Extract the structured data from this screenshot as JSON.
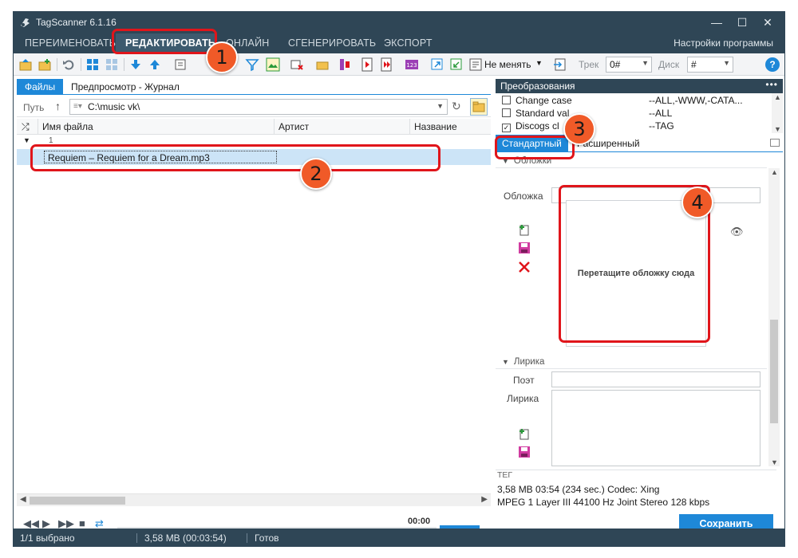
{
  "window": {
    "title": "TagScanner 6.1.16",
    "controls": [
      "—",
      "☐",
      "✕"
    ]
  },
  "menu": {
    "items": [
      "ПЕРЕИМЕНОВАТЬ",
      "РЕДАКТИРОВАТЬ",
      "ОНЛАЙН",
      "СГЕНЕРИРОВАТЬ",
      "ЭКСПОРТ"
    ],
    "active_index": 1,
    "settings": "Настройки программы"
  },
  "toolbar": {
    "keep_mode": "Не менять",
    "track_label": "Трек",
    "track_value": "0#",
    "disc_label": "Диск",
    "disc_value": "#",
    "help": "?"
  },
  "left_panel": {
    "tabs": [
      "Файлы",
      "Предпросмотр - Журнал"
    ],
    "path_label": "Путь",
    "path_value": "C:\\music vk\\",
    "columns": [
      "Имя файла",
      "Артист",
      "Название"
    ],
    "group_number": "1",
    "files": [
      {
        "name": "Requiem – Requiem for a Dream.mp3"
      }
    ]
  },
  "player": {
    "time": "00:00"
  },
  "right_panel": {
    "transform_title": "Преобразования",
    "transforms": [
      {
        "name": "Change case",
        "value": "--ALL,-WWW,-CATA...",
        "checked": false
      },
      {
        "name": "Standard val",
        "value": "--ALL",
        "checked": false
      },
      {
        "name": "Discogs cl",
        "value": "--TAG",
        "checked": true
      }
    ],
    "mode_tabs": [
      "Стандартный",
      "Расширенный"
    ],
    "covers_section": "Обложки",
    "cover_label": "Обложка",
    "drop_text": "Перетащите обложку сюда",
    "lyrics_section": "Лирика",
    "poet_label": "Поэт",
    "lyrics_label": "Лирика",
    "tag_label": "ТЕГ",
    "info_line1": "3,58 MB  03:54 (234 sec.)  Codec: Xing",
    "info_line2": "MPEG 1 Layer III  44100 Hz  Joint Stereo  128 kbps",
    "save": "Сохранить"
  },
  "status": {
    "selected": "1/1 выбрано",
    "size": "3,58 MB (00:03:54)",
    "state": "Готов"
  },
  "annotations": [
    "1",
    "2",
    "3",
    "4"
  ],
  "colors": {
    "titlebar": "#2f4656",
    "accent": "#1e88d8",
    "selection": "#cce4f7",
    "annotation_red": "#e0151b",
    "badge_orange": "#f05a28"
  }
}
